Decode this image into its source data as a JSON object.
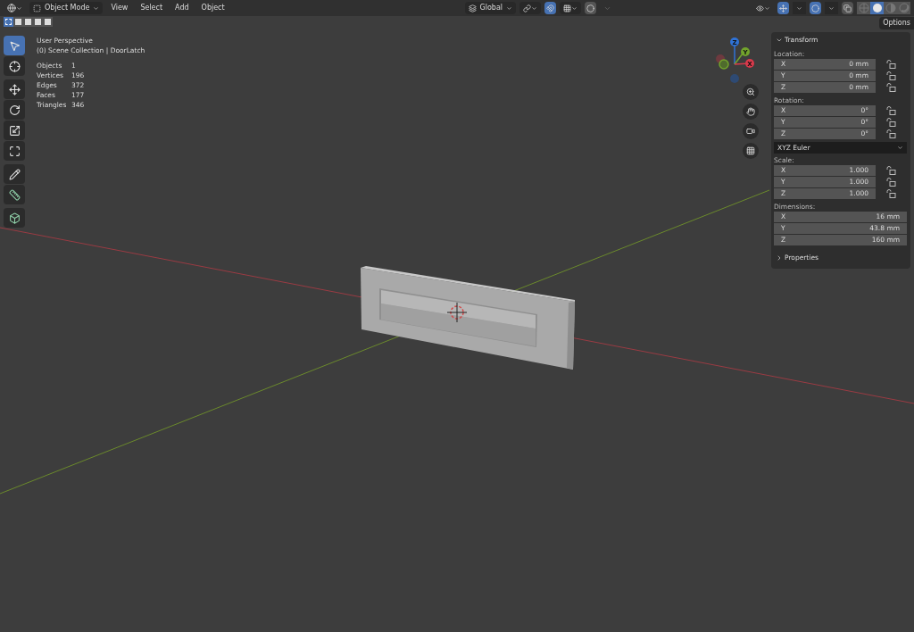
{
  "header": {
    "mode": "Object Mode",
    "menus": [
      "View",
      "Select",
      "Add",
      "Object"
    ],
    "orientation": "Global",
    "snap_on": true,
    "proportional_on": false,
    "gizmo_on": true,
    "overlay_on": true,
    "shading": [
      {
        "kind": "wireframe",
        "selected": false
      },
      {
        "kind": "solid",
        "selected": true
      },
      {
        "kind": "material",
        "selected": false
      },
      {
        "kind": "rendered",
        "selected": false
      }
    ]
  },
  "select_modes": [
    {
      "kind": "set",
      "selected": true
    },
    {
      "kind": "extend",
      "selected": false
    },
    {
      "kind": "subtract",
      "selected": false
    },
    {
      "kind": "invert",
      "selected": false
    },
    {
      "kind": "intersect",
      "selected": false
    }
  ],
  "options_button": "Options",
  "viewport_info": {
    "view": "User Perspective",
    "collection": "(0) Scene Collection | DoorLatch",
    "stats": [
      {
        "label": "Objects",
        "value": "1"
      },
      {
        "label": "Vertices",
        "value": "196"
      },
      {
        "label": "Edges",
        "value": "372"
      },
      {
        "label": "Faces",
        "value": "177"
      },
      {
        "label": "Triangles",
        "value": "346"
      }
    ]
  },
  "toolbar": [
    {
      "kind": "select",
      "selected": true
    },
    {
      "kind": "cursor",
      "selected": false
    },
    {
      "kind": "move",
      "selected": false
    },
    {
      "kind": "rotate",
      "selected": false
    },
    {
      "kind": "scale",
      "selected": false
    },
    {
      "kind": "transform",
      "selected": false
    },
    {
      "kind": "annotate",
      "selected": false
    },
    {
      "kind": "measure",
      "selected": false
    },
    {
      "kind": "add",
      "selected": false
    }
  ],
  "gizmo": {
    "axes": [
      {
        "label": "Z",
        "color": "#2f72d6"
      },
      {
        "label": "Y",
        "color": "#72a32c"
      },
      {
        "label": "X",
        "color": "#d83a4b"
      }
    ]
  },
  "sidebar": {
    "title": "Transform",
    "expanded": true,
    "groups": [
      {
        "label": "Location:",
        "locks": true,
        "fields": [
          {
            "axis": "X",
            "value": "0 mm"
          },
          {
            "axis": "Y",
            "value": "0 mm"
          },
          {
            "axis": "Z",
            "value": "0 mm"
          }
        ]
      },
      {
        "label": "Rotation:",
        "locks": true,
        "fields": [
          {
            "axis": "X",
            "value": "0°"
          },
          {
            "axis": "Y",
            "value": "0°"
          },
          {
            "axis": "Z",
            "value": "0°"
          }
        ],
        "mode": "XYZ Euler"
      },
      {
        "label": "Scale:",
        "locks": true,
        "fields": [
          {
            "axis": "X",
            "value": "1.000"
          },
          {
            "axis": "Y",
            "value": "1.000"
          },
          {
            "axis": "Z",
            "value": "1.000"
          }
        ]
      },
      {
        "label": "Dimensions:",
        "locks": false,
        "fields": [
          {
            "axis": "X",
            "value": "16 mm"
          },
          {
            "axis": "Y",
            "value": "43.8 mm"
          },
          {
            "axis": "Z",
            "value": "160 mm"
          }
        ]
      }
    ],
    "properties": {
      "title": "Properties",
      "expanded": false
    }
  }
}
